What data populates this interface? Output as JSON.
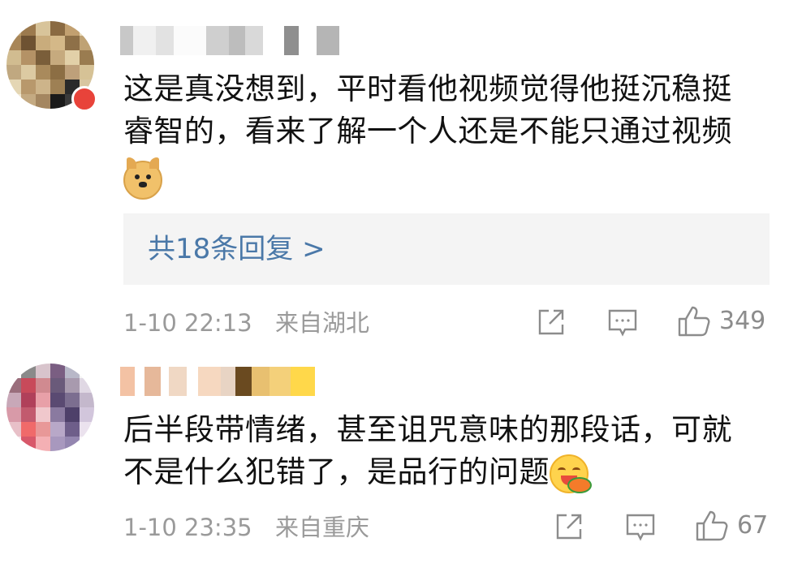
{
  "comments": [
    {
      "text_line1": "这是真没想到，平时看他视频觉得他挺沉稳挺",
      "text_line2": "睿智的，看来了解一个人还是不能只通过视频",
      "emoji": "doge",
      "replies_label": "共18条回复 >",
      "time": "1-10 22:13",
      "location": "来自湖北",
      "likes": "349"
    },
    {
      "text_line1": "后半段带情绪，甚至诅咒意味的那段话，可就",
      "text_line2": "不是什么犯错了，是品行的问题",
      "emoji": "yum",
      "time": "1-10 23:35",
      "location": "来自重庆",
      "likes": "67"
    }
  ],
  "icons": [
    "share-icon",
    "comment-icon",
    "like-icon"
  ],
  "colors": {
    "reply_link": "#4a78a8",
    "meta_text": "#9a9a9a",
    "reply_box_bg": "#f4f4f4"
  }
}
